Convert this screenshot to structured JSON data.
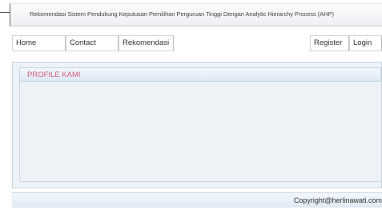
{
  "header": {
    "title": "Rekomendasi Sistem Pendukung Keputusan Pemilihan Perguruan Tinggi Dengan Analytic Hierarchy Process (AHP)"
  },
  "nav": {
    "home": "Home",
    "contact": "Contact",
    "rekomendasi": "Rekomendasi",
    "register": "Register",
    "login": "Login"
  },
  "content": {
    "title": "PROFILE KAMI"
  },
  "footer": {
    "copyright": "Copyright@herlinawati.com"
  },
  "colors": {
    "accent_title": "#d45a7a",
    "panel_header": "#dde9f6",
    "panel_body": "#eef2f6"
  }
}
